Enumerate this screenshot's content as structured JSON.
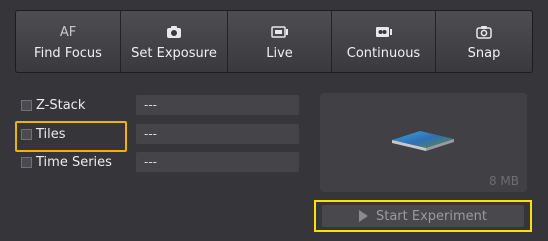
{
  "toolbar": {
    "af_text": "AF",
    "buttons": [
      {
        "label": "Find Focus",
        "icon": "af-text-icon"
      },
      {
        "label": "Set Exposure",
        "icon": "camera-icon"
      },
      {
        "label": "Live",
        "icon": "live-camera-icon"
      },
      {
        "label": "Continuous",
        "icon": "continuous-camera-icon"
      },
      {
        "label": "Snap",
        "icon": "snap-camera-icon"
      }
    ]
  },
  "options": [
    {
      "label": "Z-Stack",
      "value": "---",
      "checked": false
    },
    {
      "label": "Tiles",
      "value": "---",
      "checked": false
    },
    {
      "label": "Time Series",
      "value": "---",
      "checked": false
    }
  ],
  "preview": {
    "size": "8 MB"
  },
  "start": {
    "label": "Start Experiment"
  },
  "colors": {
    "highlight_orange": "#f0b400",
    "highlight_yellow": "#ffe000"
  }
}
